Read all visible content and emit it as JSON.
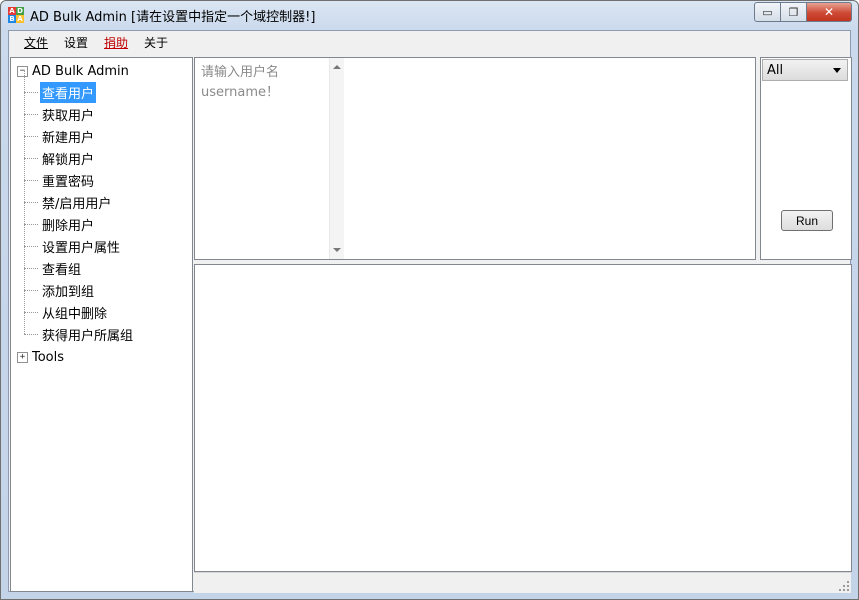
{
  "window": {
    "title": "AD Bulk Admin [请在设置中指定一个域控制器!]",
    "icon_letters": [
      "A",
      "D",
      "B",
      "A"
    ],
    "icon_colors": [
      "#e53935",
      "#43a047",
      "#1e88e5",
      "#fbc02d"
    ],
    "controls": {
      "minimize": "▭",
      "maximize": "❐",
      "close": "✕"
    }
  },
  "menu": {
    "file": "文件",
    "settings": "设置",
    "donate": "捐助",
    "about": "关于"
  },
  "tree": {
    "root_expander": "−",
    "root_label": "AD Bulk Admin",
    "items": [
      "查看用户",
      "获取用户",
      "新建用户",
      "解锁用户",
      "重置密码",
      "禁/启用用户",
      "删除用户",
      "设置用户属性",
      "查看组",
      "添加到组",
      "从组中删除",
      "获得用户所属组"
    ],
    "selected_index": 0,
    "tools_expander": "+",
    "tools_label": "Tools"
  },
  "input": {
    "placeholder": "请输入用户名\nusername！"
  },
  "filter": {
    "selected": "All"
  },
  "run_button": "Run",
  "colors": {
    "selection": "#3399ff",
    "donate_text": "#c00000"
  }
}
